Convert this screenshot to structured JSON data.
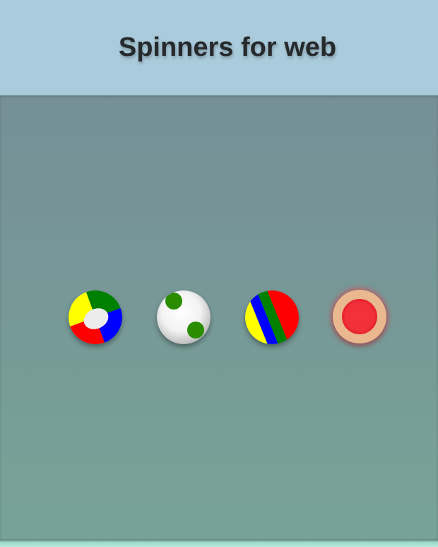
{
  "header": {
    "title": "Spinners for web"
  },
  "spinners": [
    {
      "kind": "quadrant-ring",
      "colors": [
        "#ffff00",
        "#008000",
        "#0000ff",
        "#ff0000"
      ],
      "center_color": "#ececec"
    },
    {
      "kind": "dots-ball",
      "ball_color": "#f2f2f2",
      "dot_color": "#2a8c00"
    },
    {
      "kind": "striped-ball",
      "colors": [
        "#ffff00",
        "#0000ff",
        "#008000",
        "#ff0000"
      ]
    },
    {
      "kind": "pulse-ring",
      "ring_color": "#e9b88e",
      "core_color": "#f0303a"
    }
  ]
}
